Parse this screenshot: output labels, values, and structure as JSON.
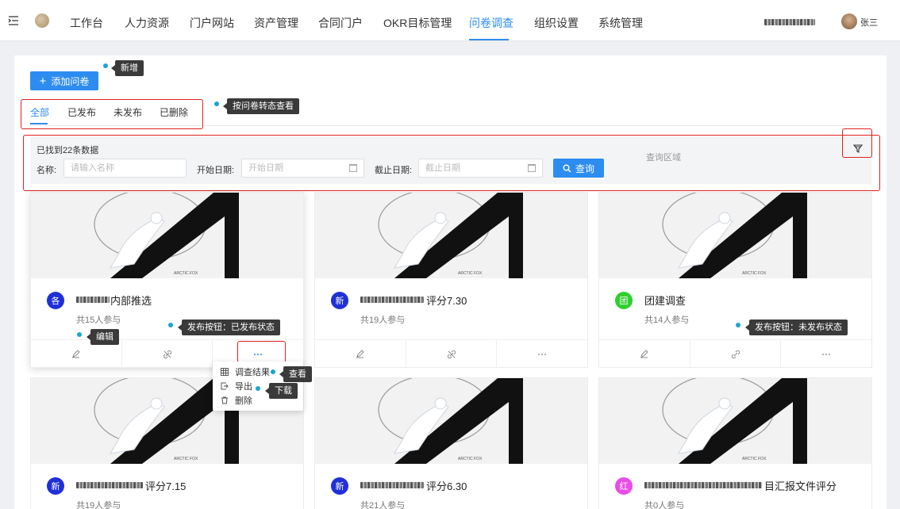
{
  "nav": {
    "items": [
      "工作台",
      "人力资源",
      "门户网站",
      "资产管理",
      "合同门户",
      "OKR目标管理",
      "问卷调查",
      "组织设置",
      "系统管理"
    ],
    "active_index": 6,
    "user_name": "张三"
  },
  "toolbar": {
    "add_label": "添加问卷"
  },
  "tabs": [
    "全部",
    "已发布",
    "未发布",
    "已删除"
  ],
  "tooltips": {
    "add": "新增",
    "tabs": "按问卷转态查看",
    "published_btn": "发布按钮：已发布状态",
    "unpublished_btn": "发布按钮：未发布状态",
    "edit": "编辑",
    "view": "查看",
    "download": "下载"
  },
  "query": {
    "found_text": "已找到22条数据",
    "name_label": "名称:",
    "name_placeholder": "请输入名称",
    "start_label": "开始日期:",
    "start_placeholder": "开始日期",
    "end_label": "截止日期:",
    "end_placeholder": "截止日期",
    "search_label": "查询",
    "area_label": "查询区域"
  },
  "cards": [
    {
      "badge": "各",
      "badge_color": "#1f2fd9",
      "title_suffix": "内部推选",
      "participants": "共15人参与"
    },
    {
      "badge": "新",
      "badge_color": "#1f2fd9",
      "title_suffix": "评分7.30",
      "participants": "共19人参与"
    },
    {
      "badge": "团",
      "badge_color": "#2fd02f",
      "title_suffix": "团建调查",
      "participants": "共14人参与"
    },
    {
      "badge": "新",
      "badge_color": "#1f2fd9",
      "title_suffix": "评分7.15",
      "participants": "共19人参与"
    },
    {
      "badge": "新",
      "badge_color": "#1f2fd9",
      "title_suffix": "评分6.30",
      "participants": "共21人参与"
    },
    {
      "badge": "红",
      "badge_color": "#e84de8",
      "title_suffix": "目汇报文件评分",
      "participants": "共0人参与"
    }
  ],
  "card_image_caption": "ARCTIC FOX",
  "dropdown": {
    "items": [
      "调查结果",
      "导出",
      "删除"
    ]
  },
  "colors": {
    "accent": "#2d8cf0",
    "annotation_red": "#e02020",
    "tooltip_bg": "#3a3a3a",
    "dot": "#19a4d6"
  }
}
